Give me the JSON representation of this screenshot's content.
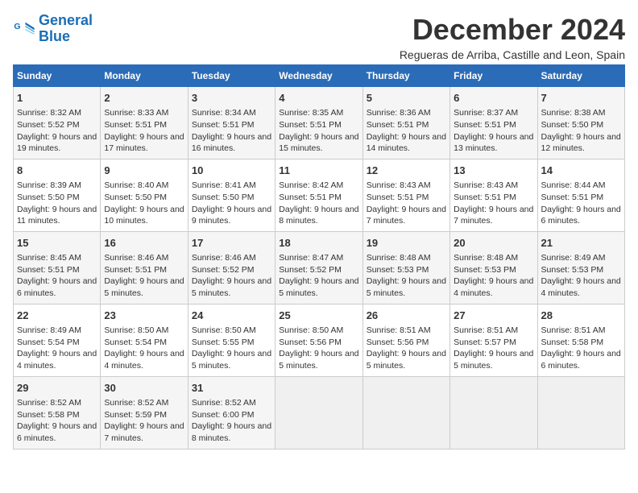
{
  "logo": {
    "line1": "General",
    "line2": "Blue"
  },
  "title": "December 2024",
  "location": "Regueras de Arriba, Castille and Leon, Spain",
  "days_of_week": [
    "Sunday",
    "Monday",
    "Tuesday",
    "Wednesday",
    "Thursday",
    "Friday",
    "Saturday"
  ],
  "weeks": [
    [
      {
        "day": 1,
        "sunrise": "8:32 AM",
        "sunset": "5:52 PM",
        "daylight": "9 hours and 19 minutes"
      },
      {
        "day": 2,
        "sunrise": "8:33 AM",
        "sunset": "5:51 PM",
        "daylight": "9 hours and 17 minutes"
      },
      {
        "day": 3,
        "sunrise": "8:34 AM",
        "sunset": "5:51 PM",
        "daylight": "9 hours and 16 minutes"
      },
      {
        "day": 4,
        "sunrise": "8:35 AM",
        "sunset": "5:51 PM",
        "daylight": "9 hours and 15 minutes"
      },
      {
        "day": 5,
        "sunrise": "8:36 AM",
        "sunset": "5:51 PM",
        "daylight": "9 hours and 14 minutes"
      },
      {
        "day": 6,
        "sunrise": "8:37 AM",
        "sunset": "5:51 PM",
        "daylight": "9 hours and 13 minutes"
      },
      {
        "day": 7,
        "sunrise": "8:38 AM",
        "sunset": "5:50 PM",
        "daylight": "9 hours and 12 minutes"
      }
    ],
    [
      {
        "day": 8,
        "sunrise": "8:39 AM",
        "sunset": "5:50 PM",
        "daylight": "9 hours and 11 minutes"
      },
      {
        "day": 9,
        "sunrise": "8:40 AM",
        "sunset": "5:50 PM",
        "daylight": "9 hours and 10 minutes"
      },
      {
        "day": 10,
        "sunrise": "8:41 AM",
        "sunset": "5:50 PM",
        "daylight": "9 hours and 9 minutes"
      },
      {
        "day": 11,
        "sunrise": "8:42 AM",
        "sunset": "5:51 PM",
        "daylight": "9 hours and 8 minutes"
      },
      {
        "day": 12,
        "sunrise": "8:43 AM",
        "sunset": "5:51 PM",
        "daylight": "9 hours and 7 minutes"
      },
      {
        "day": 13,
        "sunrise": "8:43 AM",
        "sunset": "5:51 PM",
        "daylight": "9 hours and 7 minutes"
      },
      {
        "day": 14,
        "sunrise": "8:44 AM",
        "sunset": "5:51 PM",
        "daylight": "9 hours and 6 minutes"
      }
    ],
    [
      {
        "day": 15,
        "sunrise": "8:45 AM",
        "sunset": "5:51 PM",
        "daylight": "9 hours and 6 minutes"
      },
      {
        "day": 16,
        "sunrise": "8:46 AM",
        "sunset": "5:51 PM",
        "daylight": "9 hours and 5 minutes"
      },
      {
        "day": 17,
        "sunrise": "8:46 AM",
        "sunset": "5:52 PM",
        "daylight": "9 hours and 5 minutes"
      },
      {
        "day": 18,
        "sunrise": "8:47 AM",
        "sunset": "5:52 PM",
        "daylight": "9 hours and 5 minutes"
      },
      {
        "day": 19,
        "sunrise": "8:48 AM",
        "sunset": "5:53 PM",
        "daylight": "9 hours and 5 minutes"
      },
      {
        "day": 20,
        "sunrise": "8:48 AM",
        "sunset": "5:53 PM",
        "daylight": "9 hours and 4 minutes"
      },
      {
        "day": 21,
        "sunrise": "8:49 AM",
        "sunset": "5:53 PM",
        "daylight": "9 hours and 4 minutes"
      }
    ],
    [
      {
        "day": 22,
        "sunrise": "8:49 AM",
        "sunset": "5:54 PM",
        "daylight": "9 hours and 4 minutes"
      },
      {
        "day": 23,
        "sunrise": "8:50 AM",
        "sunset": "5:54 PM",
        "daylight": "9 hours and 4 minutes"
      },
      {
        "day": 24,
        "sunrise": "8:50 AM",
        "sunset": "5:55 PM",
        "daylight": "9 hours and 5 minutes"
      },
      {
        "day": 25,
        "sunrise": "8:50 AM",
        "sunset": "5:56 PM",
        "daylight": "9 hours and 5 minutes"
      },
      {
        "day": 26,
        "sunrise": "8:51 AM",
        "sunset": "5:56 PM",
        "daylight": "9 hours and 5 minutes"
      },
      {
        "day": 27,
        "sunrise": "8:51 AM",
        "sunset": "5:57 PM",
        "daylight": "9 hours and 5 minutes"
      },
      {
        "day": 28,
        "sunrise": "8:51 AM",
        "sunset": "5:58 PM",
        "daylight": "9 hours and 6 minutes"
      }
    ],
    [
      {
        "day": 29,
        "sunrise": "8:52 AM",
        "sunset": "5:58 PM",
        "daylight": "9 hours and 6 minutes"
      },
      {
        "day": 30,
        "sunrise": "8:52 AM",
        "sunset": "5:59 PM",
        "daylight": "9 hours and 7 minutes"
      },
      {
        "day": 31,
        "sunrise": "8:52 AM",
        "sunset": "6:00 PM",
        "daylight": "9 hours and 8 minutes"
      },
      null,
      null,
      null,
      null
    ]
  ]
}
